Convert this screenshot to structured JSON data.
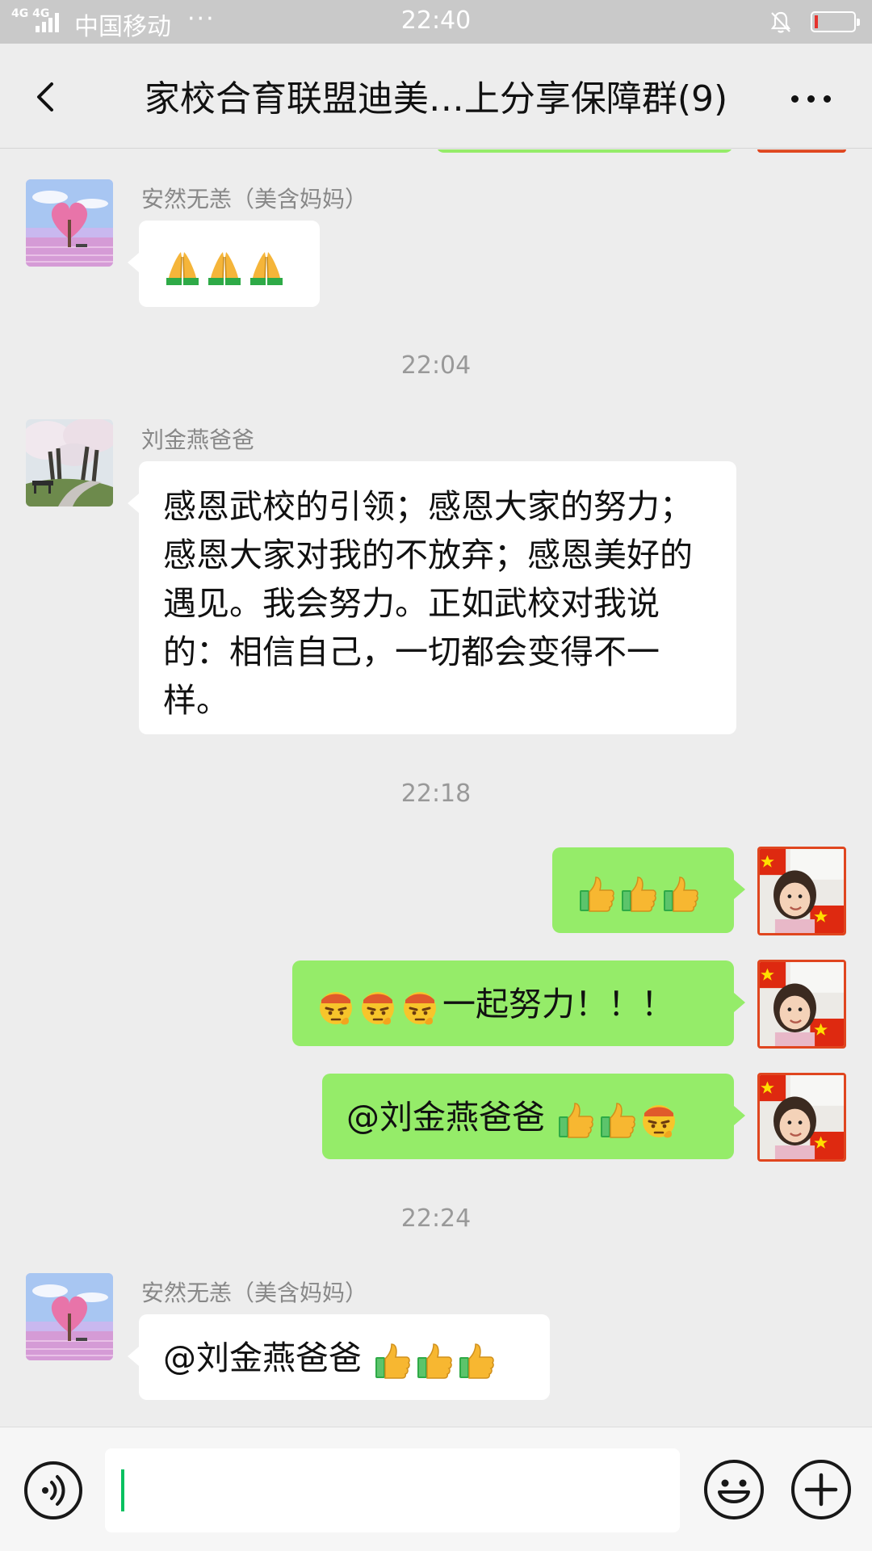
{
  "status_bar": {
    "network": "4G 4G",
    "carrier": "中国移动",
    "more_indicator": "···",
    "time": "22:40",
    "battery_level": 0.08
  },
  "header": {
    "title": "家校合育联盟迪美…上分享保障群(9)",
    "back_icon": "chevron-left-icon",
    "more_icon": "ellipsis-icon"
  },
  "messages": [
    {
      "type": "in",
      "sender": "安然无恙（美含妈妈）",
      "emojis": [
        "pray",
        "pray",
        "pray"
      ]
    },
    {
      "type": "time",
      "text": "22:04"
    },
    {
      "type": "in",
      "sender": "刘金燕爸爸",
      "text": "感恩武校的引领；感恩大家的努力；感恩大家对我的不放弃；感恩美好的遇见。我会努力。正如武校对我说的：相信自己，一切都会变得不一样。"
    },
    {
      "type": "time",
      "text": "22:18"
    },
    {
      "type": "out",
      "emojis": [
        "thumbs-up",
        "thumbs-up",
        "thumbs-up"
      ]
    },
    {
      "type": "out",
      "emojis": [
        "determined-face",
        "determined-face",
        "determined-face"
      ],
      "text": "一起努力！！！"
    },
    {
      "type": "out",
      "text": "@刘金燕爸爸 ",
      "emojis": [
        "thumbs-up",
        "thumbs-up",
        "determined-face"
      ]
    },
    {
      "type": "time",
      "text": "22:24"
    },
    {
      "type": "in",
      "sender": "安然无恙（美含妈妈）",
      "text": "@刘金燕爸爸 ",
      "emojis": [
        "thumbs-up",
        "thumbs-up",
        "thumbs-up"
      ]
    }
  ],
  "input_bar": {
    "value": "",
    "voice_icon": "voice-icon",
    "emoji_icon": "smiley-icon",
    "plus_icon": "plus-icon"
  },
  "colors": {
    "outgoing_bubble": "#95ec69",
    "incoming_bubble": "#ffffff",
    "background": "#ededed",
    "caret": "#07c160"
  }
}
